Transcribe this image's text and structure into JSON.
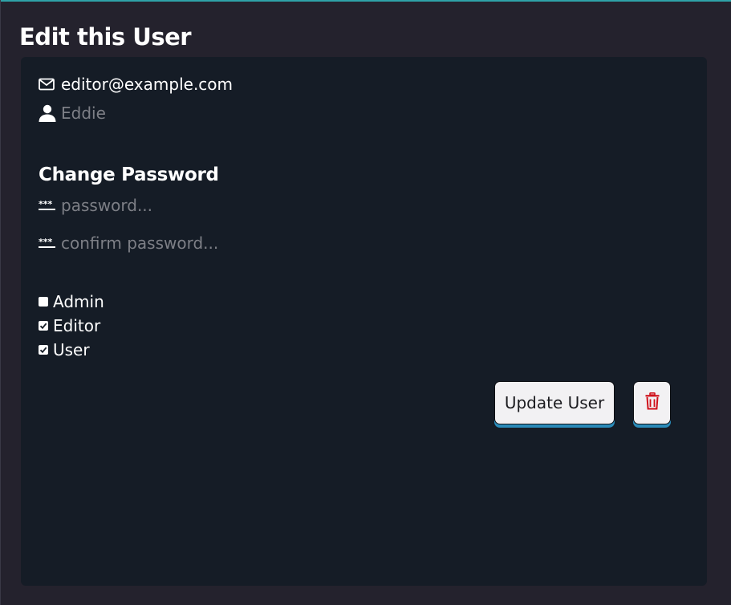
{
  "page": {
    "title": "Edit this User"
  },
  "user": {
    "email": "editor@example.com",
    "name": "Eddie"
  },
  "password_section": {
    "heading": "Change Password",
    "password_placeholder": "password...",
    "confirm_placeholder": "confirm password..."
  },
  "roles": [
    {
      "label": "Admin",
      "checked": false
    },
    {
      "label": "Editor",
      "checked": true
    },
    {
      "label": "User",
      "checked": true
    }
  ],
  "actions": {
    "update_label": "Update User",
    "delete_icon": "trash-icon"
  },
  "colors": {
    "background": "#24222d",
    "card": "#151c26",
    "accent": "#2fa2a8",
    "button_shadow": "#2a8ab8",
    "delete": "#d0111b",
    "muted_text": "#7d7f86"
  }
}
